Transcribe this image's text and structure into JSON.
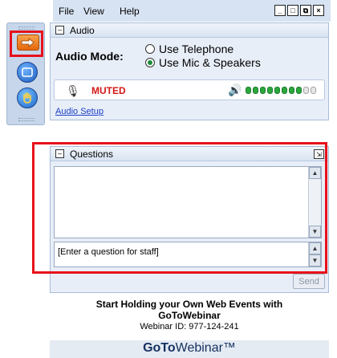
{
  "menu": {
    "file": "File",
    "view": "View",
    "help": "Help"
  },
  "window_buttons": {
    "minimize": "_",
    "restore": "□",
    "popout": "⧉",
    "close": "×"
  },
  "audio": {
    "title": "Audio",
    "mode_label": "Audio Mode:",
    "options": [
      {
        "label": "Use Telephone",
        "selected": false
      },
      {
        "label": "Use Mic & Speakers",
        "selected": true
      }
    ],
    "mic_status": "MUTED",
    "speaker_level": 8,
    "speaker_max": 10,
    "setup_link": "Audio Setup"
  },
  "questions": {
    "title": "Questions",
    "placeholder": "[Enter a question for staff]",
    "send_label": "Send"
  },
  "promo": {
    "line1": "Start Holding your Own Web Events with",
    "line2": "GoToWebinar",
    "webinar_id": "Webinar ID: 977-124-241"
  },
  "brand": {
    "bold": "GoTo",
    "rest": "Webinar™"
  },
  "colors": {
    "muted_red": "#d41818",
    "meter_green": "#2aa83c",
    "highlight_red": "#e8101a",
    "link_blue": "#1a3ec9"
  },
  "icons": {
    "rail": [
      "arrow-icon",
      "window-icon",
      "raise-hand-icon"
    ],
    "mic": "microphone-icon",
    "speaker": "speaker-icon"
  }
}
